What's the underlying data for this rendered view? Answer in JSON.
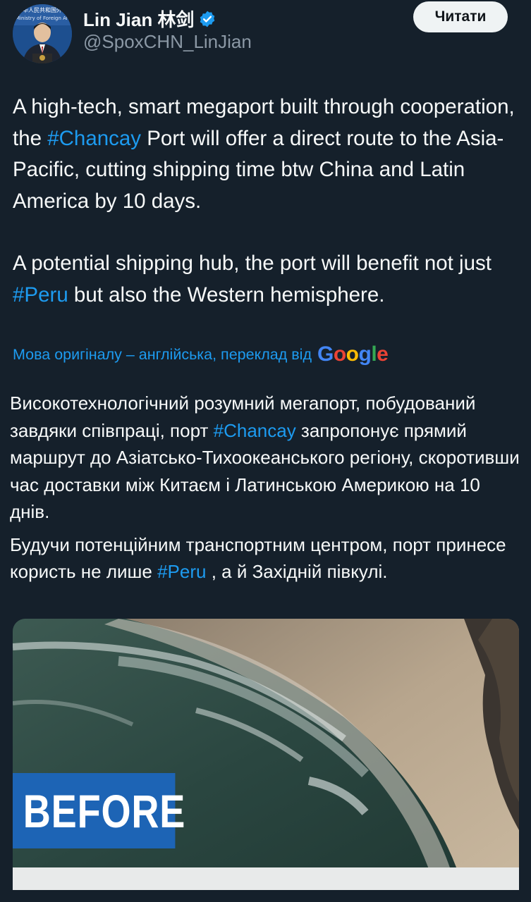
{
  "author": {
    "name": "Lin Jian 林剑",
    "handle": "@SpoxCHN_LinJian",
    "verified": true,
    "avatar_caption_line1": "中华人民共和国外",
    "avatar_caption_line2": "Ministry of Foreign Af",
    "icons": {
      "verified": "verified-badge-icon",
      "avatar": "avatar-photo"
    }
  },
  "follow_button": {
    "label": "Читати"
  },
  "tweet": {
    "p1": {
      "a": "A high-tech, smart megaport built through cooperation, the ",
      "tag": "#Chancay",
      "b": " Port will offer a direct route to the Asia-Pacific, cutting shipping time btw China and Latin America by 10 days."
    },
    "p2": {
      "a": "A potential shipping hub, the port will benefit not just ",
      "tag": "#Peru",
      "b": " but also the Western hemisphere."
    }
  },
  "translation": {
    "note": "Мова оригіналу – англійська, переклад від",
    "provider": "Google",
    "p1": {
      "a": "Високотехнологічний розумний мегапорт, побудований завдяки співпраці, порт ",
      "tag": "#Chancay",
      "b": " запропонує прямий маршрут до Азіатсько-Тихоокеанського регіону, скоротивши час доставки між Китаєм і Латинською Америкою на 10 днів."
    },
    "p2": {
      "a": "Будучи потенційним транспортним центром, порт принесе користь не лише ",
      "tag": "#Peru",
      "b": " , а й Західній півкулі."
    }
  },
  "media": {
    "overlay_text": "BEFORE",
    "colors": {
      "label_bg": "#1d64b5",
      "sea": "#2e4a44",
      "sand": "#b8a48a"
    }
  },
  "colors": {
    "background": "#15202b",
    "text": "#f7f9f9",
    "muted": "#8b98a5",
    "link": "#1d9bf0",
    "button_bg": "#eff3f4"
  }
}
